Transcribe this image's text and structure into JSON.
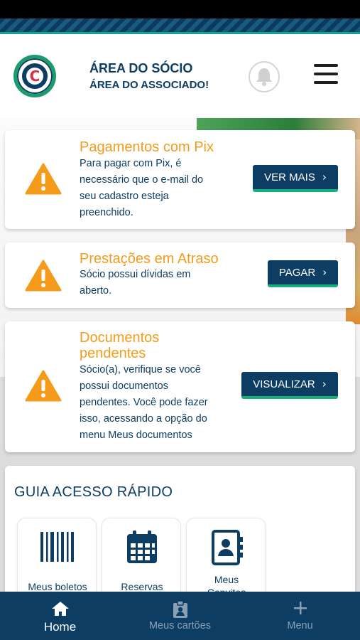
{
  "header": {
    "title": "ÁREA DO SÓCIO",
    "subtitle": "ÁREA DO ASSOCIADO!",
    "logo_icon": "club-logo-icon",
    "bell_icon": "bell-icon",
    "menu_icon": "hamburger-menu-icon"
  },
  "alerts": [
    {
      "title": "Pagamentos com Pix",
      "lines": [
        "Para pagar com Pix, é",
        "necessário que o e-mail do",
        "seu cadastro esteja",
        "preenchido."
      ],
      "action": "VER MAIS"
    },
    {
      "title": "Prestações em Atraso",
      "lines": [
        "Sócio possui dívidas em",
        "aberto."
      ],
      "action": "PAGAR"
    },
    {
      "title_lines": [
        "Documentos",
        "pendentes"
      ],
      "lines": [
        "Sócio(a), verifique se você",
        "possui documentos",
        "pendentes. Você pode fazer",
        "isso, acessando a opção do",
        "menu Meus documentos"
      ],
      "action": "VISUALIZAR"
    }
  ],
  "guide": {
    "title": "GUIA ACESSO RÁPIDO",
    "tiles": [
      {
        "label": "Meus boletos",
        "icon": "barcode-icon"
      },
      {
        "label": "Reservas",
        "icon": "calendar-icon"
      },
      {
        "label_lines": [
          "Meus",
          "Convites"
        ],
        "icon": "contact-book-icon"
      }
    ]
  },
  "bottom_nav": [
    {
      "label": "Home",
      "icon": "home-icon",
      "active": true
    },
    {
      "label": "Meus cartões",
      "icon": "id-badge-icon",
      "active": false
    },
    {
      "label": "Menu",
      "icon": "plus-icon",
      "active": false
    }
  ],
  "colors": {
    "primary": "#0d3d63",
    "accent_green": "#16b07a",
    "warning": "#f59b1c"
  }
}
